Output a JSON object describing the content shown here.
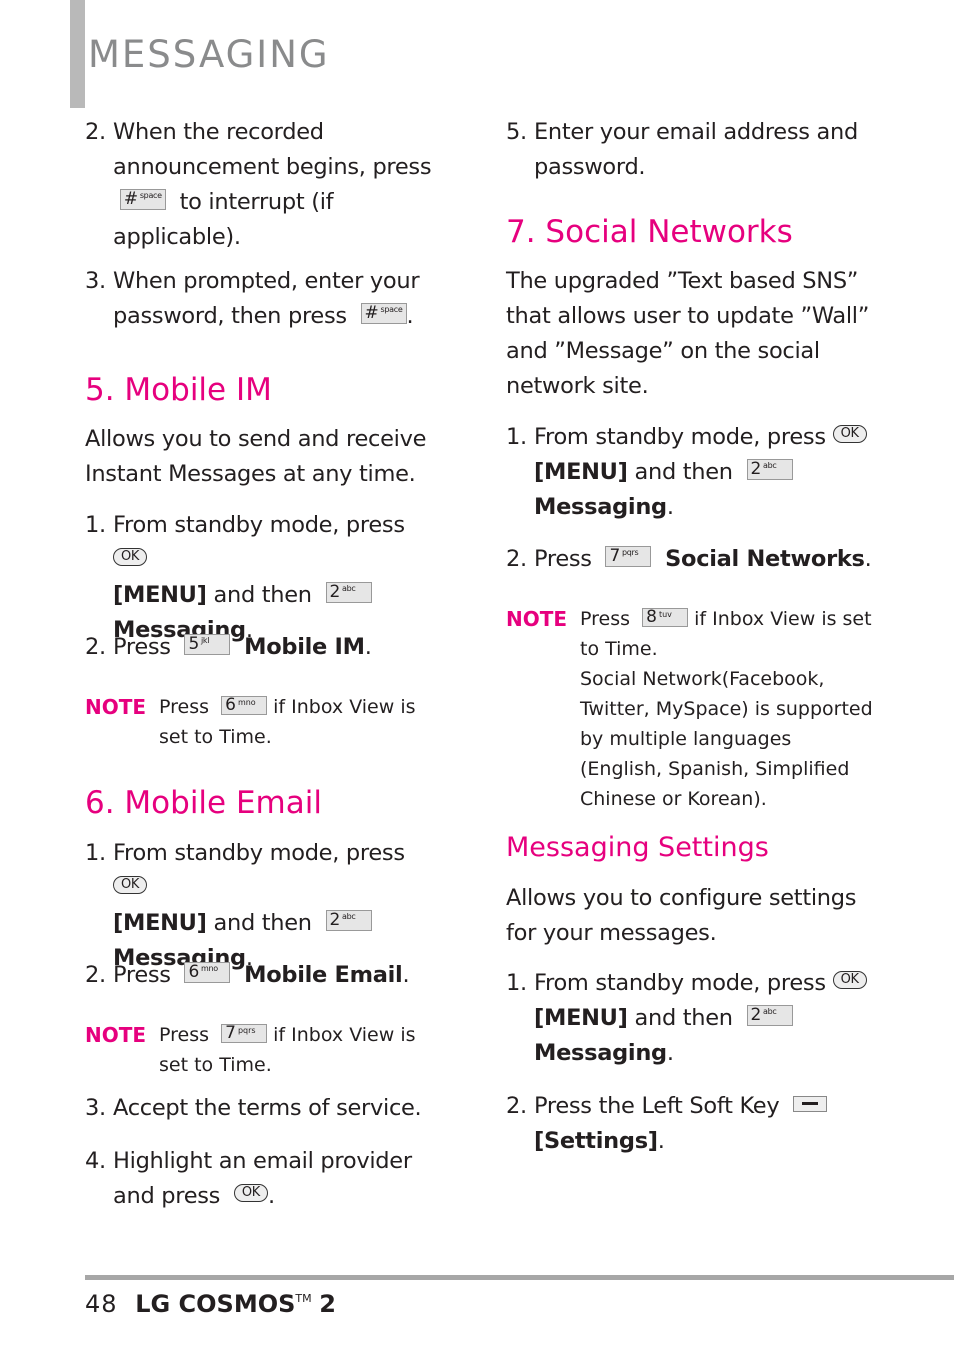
{
  "header": {
    "title": "MESSAGING"
  },
  "left": {
    "step2": {
      "num": "2.",
      "a": "When the recorded announcement begins, press",
      "key": {
        "digit": "#",
        "letters": "space"
      },
      "b": "to interrupt (if applicable)."
    },
    "step3": {
      "num": "3.",
      "a": "When prompted, enter your password, then press",
      "key": {
        "digit": "#",
        "letters": "space"
      },
      "b": "."
    },
    "mobile_im": {
      "heading": "5. Mobile IM",
      "intro": "Allows you to send and receive Instant Messages at any time.",
      "step1": {
        "num": "1.",
        "a": "From standby mode, press",
        "ok": "OK",
        "menu": "[MENU]",
        "b": "and then",
        "key": {
          "digit": "2",
          "letters": "abc"
        },
        "target": "Messaging",
        "end": "."
      },
      "step2": {
        "num": "2.",
        "a": "Press",
        "key": {
          "digit": "5",
          "letters": "jkl"
        },
        "target": "Mobile IM",
        "end": "."
      },
      "note": {
        "label": "NOTE",
        "a": "Press",
        "key": {
          "digit": "6",
          "letters": "mno"
        },
        "b": "if Inbox View is set to",
        "target": "Time",
        "end": "."
      }
    },
    "mobile_email": {
      "heading": "6. Mobile Email",
      "step1": {
        "num": "1.",
        "a": "From standby mode, press",
        "ok": "OK",
        "menu": "[MENU]",
        "b": "and then",
        "key": {
          "digit": "2",
          "letters": "abc"
        },
        "target": "Messaging",
        "end": "."
      },
      "step2": {
        "num": "2.",
        "a": "Press",
        "key": {
          "digit": "6",
          "letters": "mno"
        },
        "target": "Mobile Email",
        "end": "."
      },
      "note": {
        "label": "NOTE",
        "a": "Press",
        "key": {
          "digit": "7",
          "letters": "pqrs"
        },
        "b": "if Inbox View is set to",
        "target": "Time",
        "end": "."
      },
      "step3": {
        "num": "3.",
        "text": "Accept the terms of service."
      },
      "step4": {
        "num": "4.",
        "a": "Highlight an email provider and press",
        "ok": "OK",
        "end": "."
      }
    }
  },
  "right": {
    "step5": {
      "num": "5.",
      "text": "Enter your email address and password."
    },
    "social": {
      "heading": "7. Social Networks",
      "intro": "The upgraded ”Text based SNS” that allows user to update ”Wall” and ”Message” on the social network site.",
      "step1": {
        "num": "1.",
        "a": "From standby mode, press",
        "ok": "OK",
        "menu": "[MENU]",
        "b": "and then",
        "key": {
          "digit": "2",
          "letters": "abc"
        },
        "target": "Messaging",
        "end": "."
      },
      "step2": {
        "num": "2.",
        "a": "Press",
        "key": {
          "digit": "7",
          "letters": "pqrs"
        },
        "target": "Social Networks",
        "end": "."
      },
      "note": {
        "label": "NOTE",
        "a": "Press",
        "key": {
          "digit": "8",
          "letters": "tuv"
        },
        "b": "if Inbox View is set to",
        "target": "Time",
        "end": ".",
        "extra": "Social Network(Facebook, Twitter, MySpace) is supported by multiple languages (English, Spanish, Simplified Chinese or Korean)."
      }
    },
    "settings": {
      "heading": "Messaging Settings",
      "intro": "Allows you to configure settings for your messages.",
      "step1": {
        "num": "1.",
        "a": "From standby mode, press",
        "ok": "OK",
        "menu": "[MENU]",
        "b": "and then",
        "key": {
          "digit": "2",
          "letters": "abc"
        },
        "target": "Messaging",
        "end": "."
      },
      "step2": {
        "num": "2.",
        "a": "Press the Left Soft Key",
        "key_icon": "left-soft-key-icon",
        "target": "[Settings]",
        "end": "."
      }
    }
  },
  "footer": {
    "page_number": "48",
    "brand": "LG COSMOS",
    "tm": "TM",
    "model": "2"
  },
  "colors": {
    "accent": "#e6007e",
    "title_gray": "#8a8b8c",
    "rule_gray": "#a7a7a7"
  }
}
